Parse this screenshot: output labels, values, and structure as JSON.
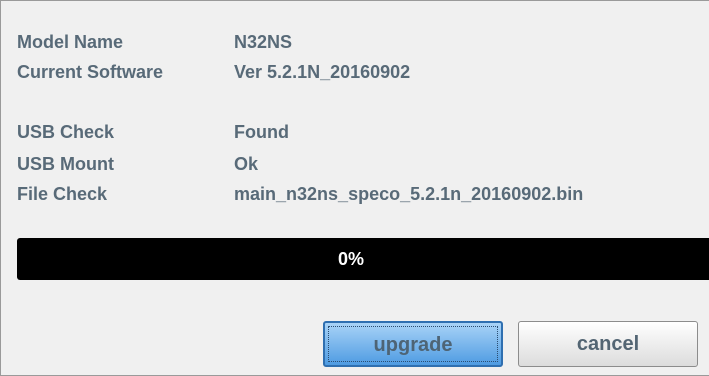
{
  "info": {
    "model_name": {
      "label": "Model Name",
      "value": "N32NS"
    },
    "current_software": {
      "label": "Current Software",
      "value": "Ver 5.2.1N_20160902"
    },
    "usb_check": {
      "label": "USB Check",
      "value": "Found"
    },
    "usb_mount": {
      "label": "USB Mount",
      "value": "Ok"
    },
    "file_check": {
      "label": "File Check",
      "value": "main_n32ns_speco_5.2.1n_20160902.bin"
    }
  },
  "progress": {
    "text": "0%",
    "fraction": 0,
    "bar_color": "#000000",
    "text_color": "#ffffff"
  },
  "buttons": {
    "upgrade_label": "upgrade",
    "cancel_label": "cancel"
  },
  "colors": {
    "label_text": "#586a78",
    "upgrade_button": "#4e9be2",
    "background": "#f0f0f0"
  }
}
